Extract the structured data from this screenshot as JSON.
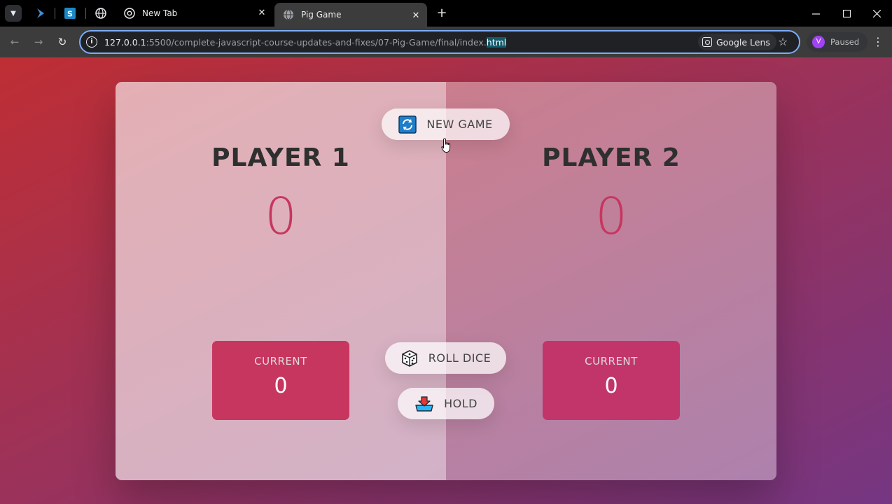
{
  "browser": {
    "tabs": [
      {
        "title": "New Tab",
        "active": false
      },
      {
        "title": "Pig Game",
        "active": true
      }
    ],
    "address": {
      "host": "127.0.0.1",
      "path_before_selection": ":5500/complete-javascript-course-updates-and-fixes/07-Pig-Game/final/index.",
      "selected_part": "html"
    },
    "lens_label": "Google Lens",
    "profile": {
      "initial": "V",
      "status": "Paused"
    }
  },
  "game": {
    "players": [
      {
        "name": "PLAYER 1",
        "score": "0",
        "current_label": "CURRENT",
        "current_score": "0"
      },
      {
        "name": "PLAYER 2",
        "score": "0",
        "current_label": "CURRENT",
        "current_score": "0"
      }
    ],
    "buttons": {
      "new_game": "NEW GAME",
      "roll_dice": "ROLL DICE",
      "hold": "HOLD"
    }
  },
  "colors": {
    "accent": "#c7365f",
    "background_start": "#bf2e34",
    "background_end": "#753682"
  }
}
